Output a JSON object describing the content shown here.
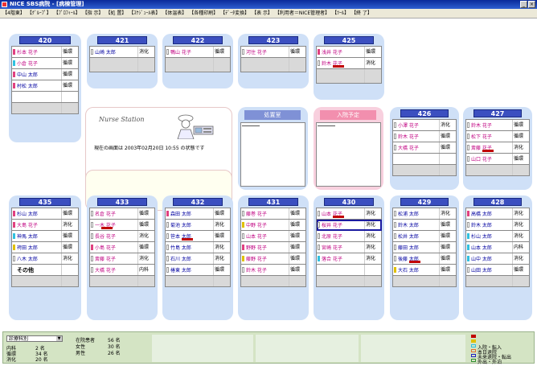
{
  "window": {
    "title": "NICE SBS病院 - [病棟管理]",
    "controls": [
      "_",
      "×"
    ]
  },
  "menu": [
    "【4階東】",
    "【ｸﾞﾙｰﾌﾟ】",
    "【ﾌﾟﾛﾌｨｰﾙ】",
    "【指 示】",
    "【処 置】",
    "【ｽｹｼﾞｭｰﾙ表】",
    "【体温表】",
    "【各種印刷】",
    "【ﾃﾞｰﾀ変換】",
    "【表 示】",
    "【利用者＝NICE管理者】",
    "【ﾂｰﾙ】",
    "【終 了】"
  ],
  "center": {
    "logo_text": "Nurse Station",
    "status_text": "現在の画面は 2003年02月20日 10:55 の状態です"
  },
  "treatment_room": {
    "title": "処置室"
  },
  "admission_plan": {
    "title": "入院予定"
  },
  "rooms": [
    {
      "number": "420",
      "beds": [
        {
          "name": "杉本 花子",
          "dept": "循環",
          "color": "#c00080"
        },
        {
          "name": "小倉 花子",
          "dept": "循環",
          "color": "#c00080"
        },
        {
          "name": "中山 太郎",
          "dept": "循環",
          "color": "#0000a0"
        },
        {
          "name": "村松 太郎",
          "dept": "循環",
          "color": "#0000a0"
        },
        {
          "name": "",
          "dept": ""
        },
        {
          "name": "",
          "dept": ""
        }
      ]
    },
    {
      "number": "421",
      "beds": [
        {
          "name": "山崎 太郎",
          "dept": "消化",
          "color": "#0000a0"
        },
        {
          "name": "",
          "dept": ""
        }
      ]
    },
    {
      "number": "422",
      "beds": [
        {
          "name": "鴨山 花子",
          "dept": "循環",
          "color": "#c00080"
        },
        {
          "name": "",
          "dept": ""
        }
      ]
    },
    {
      "number": "423",
      "beds": [
        {
          "name": "河住 花子",
          "dept": "循環",
          "color": "#c00080"
        },
        {
          "name": "",
          "dept": ""
        }
      ]
    },
    {
      "number": "425",
      "beds": [
        {
          "name": "浅井 花子",
          "dept": "循環",
          "color": "#c00080"
        },
        {
          "name": "鈴木 花子",
          "dept": "消化",
          "color": "#c00080"
        },
        {
          "name": "",
          "dept": ""
        }
      ]
    },
    {
      "number": "426",
      "beds": [
        {
          "name": "小澤 花子",
          "dept": "消化",
          "color": "#c00080"
        },
        {
          "name": "鈴木 花子",
          "dept": "循環",
          "color": "#c00080"
        },
        {
          "name": "大橋 花子",
          "dept": "循環",
          "color": "#c00080"
        },
        {
          "name": "",
          "dept": ""
        },
        {
          "name": "",
          "dept": ""
        }
      ]
    },
    {
      "number": "427",
      "beds": [
        {
          "name": "鈴木 花子",
          "dept": "循環",
          "color": "#c00080"
        },
        {
          "name": "松下 花子",
          "dept": "循環",
          "color": "#c00080"
        },
        {
          "name": "斎藤 花子",
          "dept": "消化",
          "color": "#c00080"
        },
        {
          "name": "山口 花子",
          "dept": "循環",
          "color": "#c00080"
        },
        {
          "name": "",
          "dept": ""
        }
      ]
    },
    {
      "number": "435",
      "beds": [
        {
          "name": "杉山 太郎",
          "dept": "循環",
          "color": "#0000a0"
        },
        {
          "name": "大島 花子",
          "dept": "消化",
          "color": "#c00080"
        },
        {
          "name": "神馬 太郎",
          "dept": "循環",
          "color": "#0000a0"
        },
        {
          "name": "袴田 太郎",
          "dept": "循環",
          "color": "#0000a0"
        },
        {
          "name": "八木 太郎",
          "dept": "消化",
          "color": "#0000a0"
        },
        {
          "name": "その他",
          "dept": "",
          "other": true
        },
        {
          "name": "",
          "dept": ""
        }
      ]
    },
    {
      "number": "433",
      "beds": [
        {
          "name": "名倉 花子",
          "dept": "循環",
          "color": "#c00080"
        },
        {
          "name": "一木 花子",
          "dept": "循環",
          "color": "#c00080"
        },
        {
          "name": "長谷 花子",
          "dept": "消化",
          "color": "#c00080"
        },
        {
          "name": "小島 花子",
          "dept": "循環",
          "color": "#c00080"
        },
        {
          "name": "斎藤 花子",
          "dept": "消化",
          "color": "#c00080"
        },
        {
          "name": "大橋 花子",
          "dept": "内科",
          "color": "#c00080"
        },
        {
          "name": "",
          "dept": ""
        }
      ]
    },
    {
      "number": "432",
      "beds": [
        {
          "name": "森田 太郎",
          "dept": "循環",
          "color": "#0000a0"
        },
        {
          "name": "菊池 太郎",
          "dept": "消化",
          "color": "#0000a0"
        },
        {
          "name": "笹本 太郎",
          "dept": "循環",
          "color": "#0000a0"
        },
        {
          "name": "竹島 太郎",
          "dept": "消化",
          "color": "#0000a0"
        },
        {
          "name": "石川 太郎",
          "dept": "消化",
          "color": "#0000a0"
        },
        {
          "name": "椿東 太郎",
          "dept": "循環",
          "color": "#0000a0"
        },
        {
          "name": "",
          "dept": ""
        }
      ]
    },
    {
      "number": "431",
      "beds": [
        {
          "name": "藤巻 花子",
          "dept": "循環",
          "color": "#c00080"
        },
        {
          "name": "中野 花子",
          "dept": "循環",
          "color": "#c00080"
        },
        {
          "name": "山本 花子",
          "dept": "循環",
          "color": "#c00080"
        },
        {
          "name": "野野 花子",
          "dept": "循環",
          "color": "#c00080"
        },
        {
          "name": "藤野 花子",
          "dept": "循環",
          "color": "#c00080"
        },
        {
          "name": "鈴木 花子",
          "dept": "循環",
          "color": "#c00080"
        },
        {
          "name": "",
          "dept": ""
        }
      ]
    },
    {
      "number": "430",
      "beds": [
        {
          "name": "山本 花子",
          "dept": "消化",
          "color": "#c00080"
        },
        {
          "name": "桜井 花子",
          "dept": "消化",
          "color": "#c00080"
        },
        {
          "name": "北原 花子",
          "dept": "消化",
          "color": "#c00080"
        },
        {
          "name": "宮崎 花子",
          "dept": "消化",
          "color": "#c00080"
        },
        {
          "name": "落合 花子",
          "dept": "消化",
          "color": "#c00080"
        },
        {
          "name": "",
          "dept": ""
        },
        {
          "name": "",
          "dept": ""
        }
      ]
    },
    {
      "number": "429",
      "beds": [
        {
          "name": "松浦 太郎",
          "dept": "消化",
          "color": "#0000a0"
        },
        {
          "name": "鈴木 太郎",
          "dept": "循環",
          "color": "#0000a0"
        },
        {
          "name": "松井 太郎",
          "dept": "循環",
          "color": "#0000a0"
        },
        {
          "name": "藤田 太郎",
          "dept": "循環",
          "color": "#0000a0"
        },
        {
          "name": "後藤 太郎",
          "dept": "循環",
          "color": "#0000a0"
        },
        {
          "name": "大石 太郎",
          "dept": "循環",
          "color": "#0000a0"
        },
        {
          "name": "",
          "dept": ""
        }
      ]
    },
    {
      "number": "428",
      "beds": [
        {
          "name": "高橋 太郎",
          "dept": "消化",
          "color": "#0000a0"
        },
        {
          "name": "鈴木 太郎",
          "dept": "消化",
          "color": "#0000a0"
        },
        {
          "name": "杉山 太郎",
          "dept": "消化",
          "color": "#0000a0"
        },
        {
          "name": "山本 太郎",
          "dept": "内科",
          "color": "#0000a0"
        },
        {
          "name": "山中 太郎",
          "dept": "消化",
          "color": "#0000a0"
        },
        {
          "name": "山田 太郎",
          "dept": "循環",
          "color": "#0000a0"
        },
        {
          "name": "",
          "dept": ""
        }
      ]
    }
  ],
  "summary": {
    "dept_select": "診療科別",
    "dept_stats": [
      {
        "label": "内科",
        "value": "2 名"
      },
      {
        "label": "循環",
        "value": "34 名"
      },
      {
        "label": "消化",
        "value": "20 名"
      }
    ],
    "patient_stats": [
      {
        "label": "在院患者",
        "value": "56 名"
      },
      {
        "label": "女性",
        "value": "30 名"
      },
      {
        "label": "男性",
        "value": "26 名"
      }
    ]
  },
  "legend": [
    {
      "label": "",
      "color": "#c00000"
    },
    {
      "label": "",
      "color": "#e0c000"
    },
    {
      "label": "入院・転入",
      "color": "#30c0e0"
    },
    {
      "label": "本日退院",
      "color": "#e07030"
    },
    {
      "label": "未来退院・転出",
      "color": "#2020c0"
    },
    {
      "label": "外出・外泊",
      "color": "#309030"
    }
  ]
}
